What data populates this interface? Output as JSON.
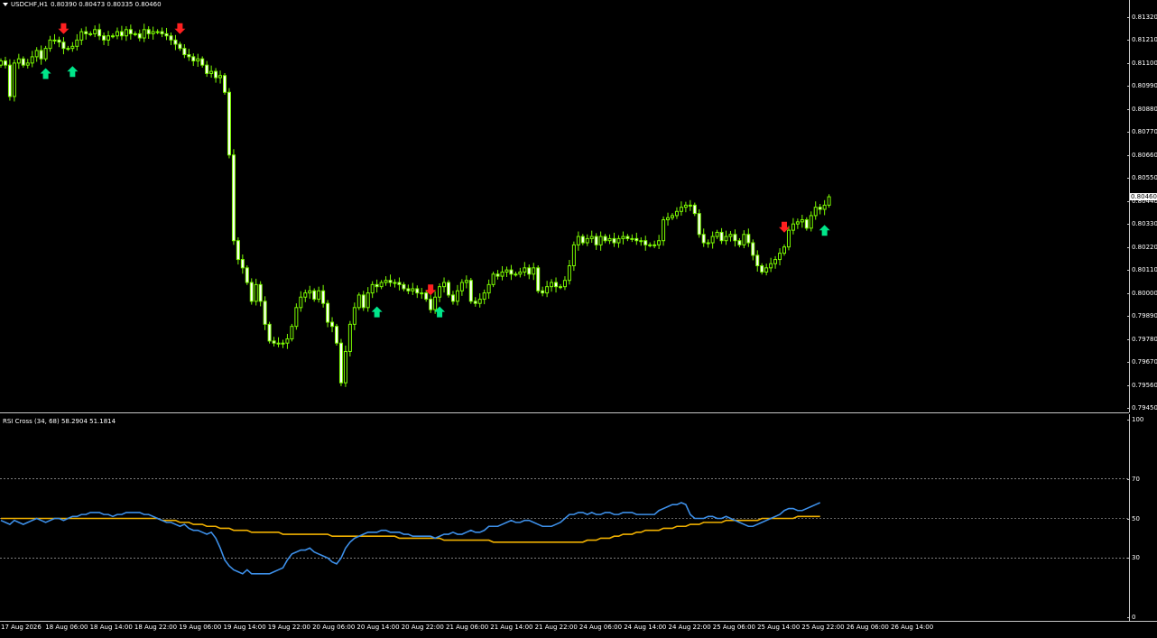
{
  "main_chart": {
    "symbol_line": "USDCHF,H1",
    "ohlc_line": "0.80390 0.80473 0.80335 0.80460",
    "price_labels": [
      "0.81320",
      "0.81210",
      "0.81100",
      "0.80990",
      "0.80880",
      "0.80770",
      "0.80660",
      "0.80550",
      "0.80440",
      "0.80330",
      "0.80220",
      "0.80110",
      "0.80000",
      "0.79890",
      "0.79780",
      "0.79670",
      "0.79560",
      "0.79450"
    ],
    "current_price": "0.80460",
    "colors": {
      "candle": "#7CFC00",
      "candle_body_bull": "#000000",
      "candle_body_bear": "#ffffff",
      "arrow_up": "#00e68a",
      "arrow_down": "#ff2020"
    },
    "signals": {
      "up_candles": [
        10,
        16,
        84,
        98,
        184
      ],
      "down_candles": [
        14,
        40,
        96,
        175
      ]
    },
    "chart_data": {
      "type": "candlestick",
      "ylim": [
        0.7945,
        0.8138
      ],
      "closes": [
        0.8111,
        0.8109,
        0.8094,
        0.811,
        0.8112,
        0.8109,
        0.811,
        0.8113,
        0.8116,
        0.8112,
        0.8117,
        0.8121,
        0.8121,
        0.812,
        0.8117,
        0.8117,
        0.8118,
        0.8121,
        0.8125,
        0.8124,
        0.8124,
        0.8126,
        0.8123,
        0.8121,
        0.8123,
        0.8123,
        0.8125,
        0.8123,
        0.8126,
        0.8124,
        0.8124,
        0.8122,
        0.8126,
        0.8124,
        0.8125,
        0.8125,
        0.8124,
        0.8123,
        0.8121,
        0.8119,
        0.8117,
        0.8114,
        0.8113,
        0.8111,
        0.8112,
        0.8109,
        0.8105,
        0.8106,
        0.8103,
        0.8104,
        0.8096,
        0.8066,
        0.8025,
        0.8016,
        0.8012,
        0.8005,
        0.7996,
        0.8004,
        0.7996,
        0.7985,
        0.7977,
        0.7976,
        0.7976,
        0.7976,
        0.7978,
        0.7984,
        0.7993,
        0.7998,
        0.8,
        0.8001,
        0.7997,
        0.8001,
        0.7995,
        0.7986,
        0.7984,
        0.7976,
        0.7957,
        0.7972,
        0.7985,
        0.7993,
        0.7999,
        0.7993,
        0.8,
        0.8004,
        0.8003,
        0.8005,
        0.8006,
        0.8005,
        0.8005,
        0.8004,
        0.8002,
        0.8001,
        0.8002,
        0.8,
        0.8,
        0.7997,
        0.7992,
        0.7998,
        0.8003,
        0.8005,
        0.7999,
        0.7996,
        0.8001,
        0.8005,
        0.8006,
        0.7996,
        0.7995,
        0.7997,
        0.8,
        0.8004,
        0.8009,
        0.8008,
        0.801,
        0.8011,
        0.8009,
        0.8009,
        0.801,
        0.8012,
        0.8009,
        0.8012,
        0.8001,
        0.8,
        0.8003,
        0.8005,
        0.8003,
        0.8003,
        0.8006,
        0.8013,
        0.8023,
        0.8027,
        0.8024,
        0.8026,
        0.8027,
        0.8023,
        0.8027,
        0.8025,
        0.8026,
        0.8024,
        0.8026,
        0.8027,
        0.8026,
        0.8026,
        0.8025,
        0.8025,
        0.8023,
        0.8023,
        0.8023,
        0.8025,
        0.8035,
        0.8036,
        0.8037,
        0.8039,
        0.8041,
        0.8042,
        0.8042,
        0.8038,
        0.8028,
        0.8024,
        0.8024,
        0.8027,
        0.8029,
        0.8025,
        0.8027,
        0.8028,
        0.8025,
        0.8023,
        0.8028,
        0.8024,
        0.8018,
        0.8013,
        0.801,
        0.8012,
        0.8014,
        0.8016,
        0.8019,
        0.8022,
        0.803,
        0.8033,
        0.8034,
        0.8035,
        0.8031,
        0.8037,
        0.8041,
        0.804,
        0.8042,
        0.8046
      ]
    }
  },
  "indicator": {
    "title": "RSI Cross (34, 68) 58.2904 51.1814",
    "scale_labels": [
      "100",
      "70",
      "50",
      "30",
      "0"
    ],
    "levels": [
      70,
      50,
      30
    ],
    "colors": {
      "fast": "#3d8fe8",
      "slow": "#f0b000",
      "level_line": "#c8c8c8"
    },
    "chart_data": {
      "type": "line",
      "ylim": [
        0,
        100
      ],
      "series": [
        {
          "values": [
            49,
            48,
            47,
            49,
            48,
            47,
            48,
            49,
            50,
            49,
            48,
            49,
            50,
            50,
            49,
            50,
            51,
            51,
            52,
            52,
            53,
            53,
            53,
            52,
            52,
            51,
            52,
            52,
            53,
            53,
            53,
            53,
            52,
            52,
            51,
            50,
            49,
            48,
            48,
            47,
            46,
            47,
            45,
            44,
            44,
            43,
            42,
            43,
            40,
            35,
            29,
            26,
            24,
            23,
            22,
            24,
            22,
            22,
            22,
            22,
            22,
            23,
            24,
            25,
            29,
            32,
            33,
            34,
            34,
            35,
            33,
            32,
            31,
            30,
            28,
            27,
            30,
            35,
            38,
            40,
            41,
            42,
            43,
            43,
            43,
            44,
            44,
            43,
            43,
            43,
            42,
            42,
            41,
            41,
            41,
            41,
            41,
            40,
            41,
            42,
            42,
            43,
            42,
            42,
            43,
            44,
            43,
            43,
            44,
            46,
            46,
            46,
            47,
            48,
            49,
            48,
            48,
            49,
            49,
            48,
            47,
            46,
            46,
            46,
            47,
            48,
            50,
            52,
            52,
            53,
            53,
            52,
            53,
            52,
            52,
            53,
            53,
            52,
            52,
            53,
            53,
            53,
            52,
            52,
            52,
            52,
            52,
            54,
            55,
            56,
            57,
            57,
            58,
            57,
            52,
            50,
            50,
            50,
            51,
            51,
            50,
            50,
            51,
            50,
            49,
            48,
            47,
            46,
            46,
            47,
            48,
            49,
            50,
            51,
            52,
            54,
            55,
            55,
            54,
            54,
            55,
            56,
            57,
            58
          ]
        },
        {
          "values": [
            50,
            50,
            50,
            50,
            50,
            50,
            50,
            50,
            50,
            50,
            50,
            50,
            50,
            50,
            50,
            50,
            50,
            50,
            50,
            50,
            50,
            50,
            50,
            50,
            50,
            50,
            50,
            50,
            50,
            50,
            50,
            50,
            50,
            50,
            50,
            50,
            49,
            49,
            49,
            49,
            48,
            48,
            48,
            47,
            47,
            47,
            46,
            46,
            46,
            45,
            45,
            45,
            44,
            44,
            44,
            44,
            43,
            43,
            43,
            43,
            43,
            43,
            43,
            42,
            42,
            42,
            42,
            42,
            42,
            42,
            42,
            42,
            42,
            42,
            41,
            41,
            41,
            41,
            41,
            41,
            41,
            41,
            41,
            41,
            41,
            41,
            41,
            41,
            41,
            40,
            40,
            40,
            40,
            40,
            40,
            40,
            40,
            40,
            40,
            39,
            39,
            39,
            39,
            39,
            39,
            39,
            39,
            39,
            39,
            39,
            38,
            38,
            38,
            38,
            38,
            38,
            38,
            38,
            38,
            38,
            38,
            38,
            38,
            38,
            38,
            38,
            38,
            38,
            38,
            38,
            38,
            39,
            39,
            39,
            40,
            40,
            40,
            41,
            41,
            42,
            42,
            42,
            43,
            43,
            44,
            44,
            44,
            44,
            45,
            45,
            45,
            46,
            46,
            46,
            47,
            47,
            47,
            48,
            48,
            48,
            48,
            48,
            49,
            49,
            49,
            49,
            49,
            49,
            49,
            49,
            50,
            50,
            50,
            50,
            50,
            50,
            50,
            50,
            51,
            51,
            51,
            51,
            51,
            51
          ]
        }
      ]
    }
  },
  "time_axis": {
    "labels": [
      "17 Aug 2026",
      "18 Aug 06:00",
      "18 Aug 14:00",
      "18 Aug 22:00",
      "19 Aug 06:00",
      "19 Aug 14:00",
      "19 Aug 22:00",
      "20 Aug 06:00",
      "20 Aug 14:00",
      "20 Aug 22:00",
      "21 Aug 06:00",
      "21 Aug 14:00",
      "21 Aug 22:00",
      "24 Aug 06:00",
      "24 Aug 14:00",
      "24 Aug 22:00",
      "25 Aug 06:00",
      "25 Aug 14:00",
      "25 Aug 22:00",
      "26 Aug 06:00",
      "26 Aug 14:00"
    ]
  }
}
